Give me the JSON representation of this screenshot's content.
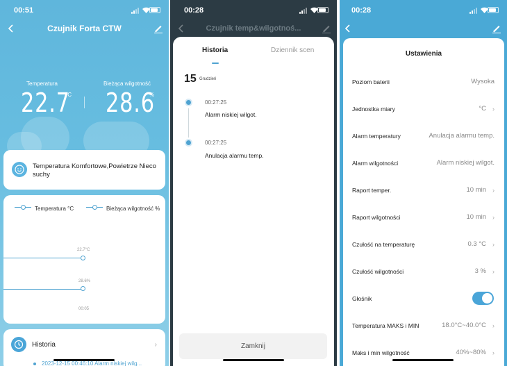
{
  "screen1": {
    "status_time": "00:51",
    "title": "Czujnik Forta CTW",
    "temperature": {
      "label": "Temperatura",
      "value": "22.7",
      "unit": "°C"
    },
    "humidity": {
      "label": "Bieżąca wilgotność",
      "value": "28.6",
      "unit": "%"
    },
    "comfort_text": "Temperatura Komfortowe,Powietrze Nieco suchy",
    "chart": {
      "legend_temp": "Temperatura °C",
      "legend_humidity": "Bieżąca wilgotność %",
      "temp_point_label": "22.7°C",
      "humidity_point_label": "28.6%",
      "time_label": "00:05"
    },
    "history": {
      "label": "Historia",
      "item": "2023-12-15 00:46:10 Alarm niskiej wilg..."
    }
  },
  "screen2": {
    "status_time": "00:28",
    "background_title": "Czujnik temp&wilgotnoś...",
    "tabs": [
      "Historia",
      "Dziennik scen"
    ],
    "day": "15",
    "month": "Grudzień",
    "events": [
      {
        "time": "00:27:25",
        "text": "Alarm niskiej wilgot."
      },
      {
        "time": "00:27:25",
        "text": "Anulacja alarmu temp."
      }
    ],
    "close_label": "Zamknij"
  },
  "screen3": {
    "status_time": "00:28",
    "title": "Ustawienia",
    "rows": [
      {
        "label": "Poziom baterii",
        "value": "Wysoka",
        "chevron": false
      },
      {
        "label": "Jednostka miary",
        "value": "°C",
        "chevron": true
      },
      {
        "label": "Alarm temperatury",
        "value": "Anulacja alarmu temp.",
        "chevron": false
      },
      {
        "label": "Alarm wilgotności",
        "value": "Alarm niskiej wilgot.",
        "chevron": false
      },
      {
        "label": "Raport temper.",
        "value": "10 min",
        "chevron": true
      },
      {
        "label": "Raport wilgotności",
        "value": "10 min",
        "chevron": true
      },
      {
        "label": "Czułość na temperaturę",
        "value": "0.3 °C",
        "chevron": true
      },
      {
        "label": "Czułość wilgotności",
        "value": "3 %",
        "chevron": true
      },
      {
        "label": "Głośnik",
        "value": "",
        "toggle": true
      },
      {
        "label": "Temperatura MAKS i MIN",
        "value": "18.0°C~40.0°C",
        "chevron": true
      },
      {
        "label": "Maks i min wilgotność",
        "value": "40%~80%",
        "chevron": true
      }
    ]
  },
  "colors": {
    "accent": "#4fa3d1",
    "header_blue": "#5fb6dc",
    "toggle_on": "#4aa5d8"
  }
}
